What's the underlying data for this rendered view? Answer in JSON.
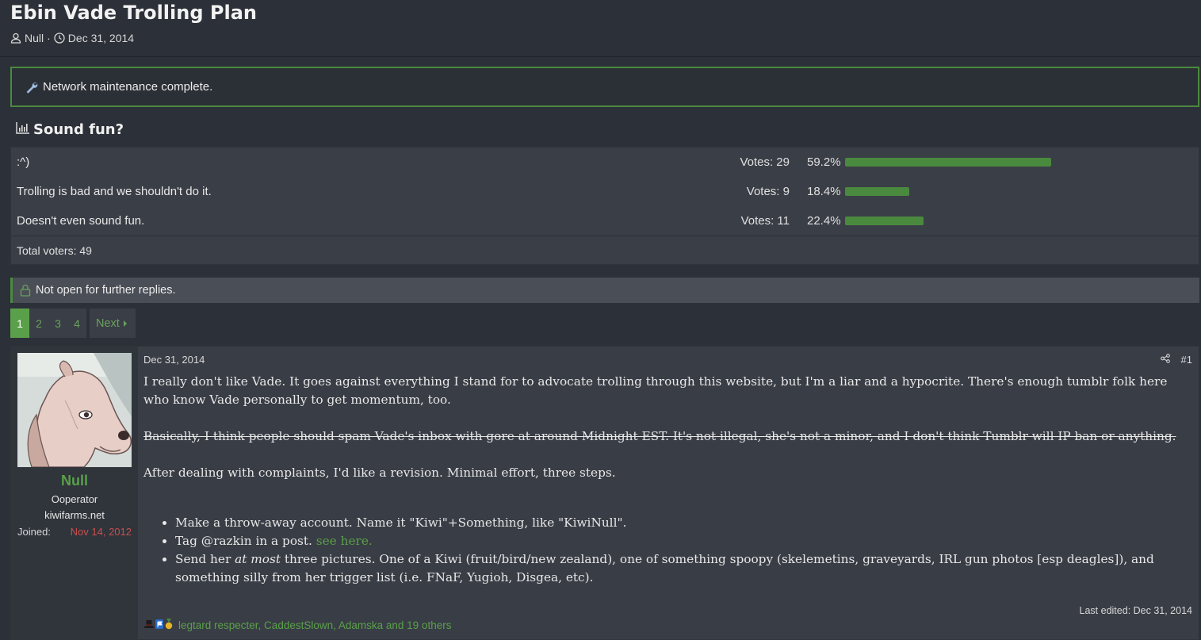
{
  "thread": {
    "title": "Ebin Vade Trolling Plan",
    "author": "Null",
    "date": "Dec 31, 2014"
  },
  "notice": {
    "text": "Network maintenance complete."
  },
  "poll": {
    "title": "Sound fun?",
    "options": [
      {
        "label": ":^)",
        "votes": "Votes: 29",
        "percent": "59.2%",
        "fraction": 0.592
      },
      {
        "label": "Trolling is bad and we shouldn't do it.",
        "votes": "Votes: 9",
        "percent": "18.4%",
        "fraction": 0.184
      },
      {
        "label": "Doesn't even sound fun.",
        "votes": "Votes: 11",
        "percent": "22.4%",
        "fraction": 0.224
      }
    ],
    "total": "Total voters: 49",
    "bar_color": "#4a8a3f"
  },
  "closed": {
    "text": "Not open for further replies."
  },
  "pagination": {
    "pages": [
      "1",
      "2",
      "3",
      "4"
    ],
    "current": "1",
    "next": "Next"
  },
  "post": {
    "user": {
      "name": "Null",
      "title": "Ooperator",
      "site": "kiwifarms.net",
      "joined_label": "Joined:",
      "joined_value": "Nov 14, 2012"
    },
    "date": "Dec 31, 2014",
    "number": "#1",
    "paragraphs": {
      "p1": "I really don't like Vade. It goes against everything I stand for to advocate trolling through this website, but I'm a liar and a hypocrite. There's enough tumblr folk here who know Vade personally to get momentum, too.",
      "p2": "Basically, I think people should spam Vade's inbox with gore at around Midnight EST. It's not illegal, she's not a minor, and I don't think Tumblr will IP ban or anything.",
      "p3": "After dealing with complaints, I'd like a revision. Minimal effort, three steps."
    },
    "steps": {
      "s1": "Make a throw-away account. Name it \"Kiwi\"+Something, like \"KiwiNull\".",
      "s2_prefix": "Tag @razkin in a post.",
      "s2_link": "see here.",
      "s3_prefix": "Send her",
      "s3_emph": "at most",
      "s3_rest": "three pictures. One of a Kiwi (fruit/bird/new zealand), one of something spoopy (skelemetins, graveyards, IRL gun photos [esp deagles]), and something silly from her trigger list (i.e. FNaF, Yugioh, Disgea, etc)."
    },
    "last_edited": "Last edited: Dec 31, 2014",
    "reactions": "legtard respecter, CaddestSlown, Adamska and 19 others"
  },
  "colors": {
    "accent": "#5aa04a",
    "background": "#2c3038",
    "joined_date": "#c85050"
  }
}
